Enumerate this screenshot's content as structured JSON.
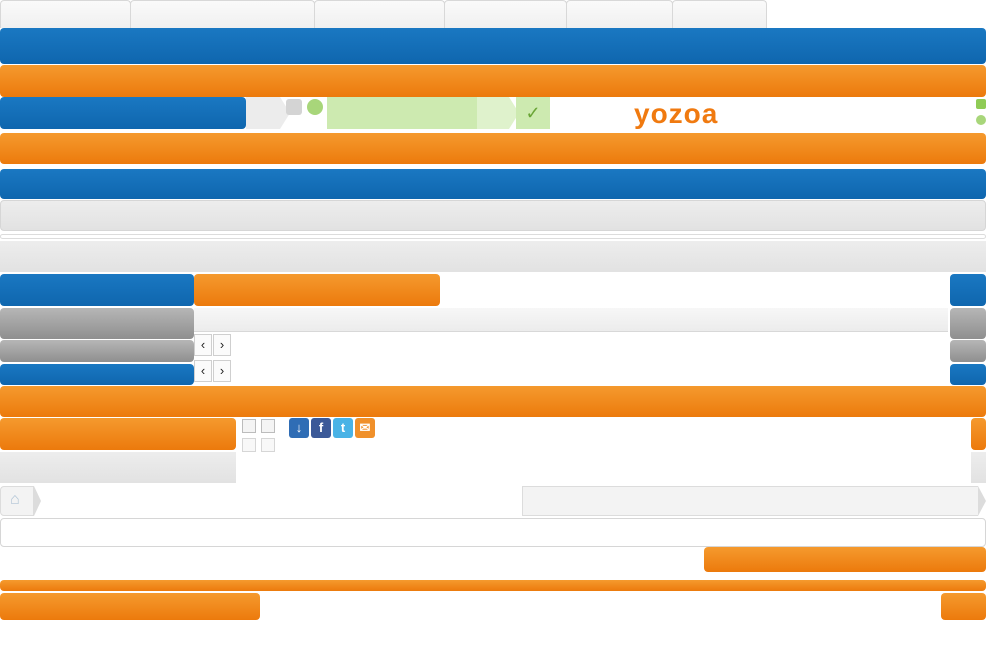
{
  "brand": {
    "logo_text": "yozoa"
  },
  "icons": {
    "prev": "chevron-left-icon",
    "next": "chevron-right-icon",
    "home": "home-icon",
    "check": "checkmark-icon",
    "grid": "grid-view-icon",
    "list": "list-view-icon"
  },
  "glyphs": {
    "prev": "‹",
    "next": "›",
    "check": "✓",
    "home": "⌂",
    "facebook": "f",
    "twitter": "t",
    "email": "✉",
    "share": "↓"
  },
  "colors": {
    "blue": "#1270b8",
    "orange": "#f08a1e",
    "grey": "#e6e6e6",
    "dark_grey": "#a3a3a3",
    "progress_green": "#cdeab0"
  },
  "share_buttons": [
    "share-icon",
    "facebook-icon",
    "twitter-icon",
    "email-icon"
  ]
}
